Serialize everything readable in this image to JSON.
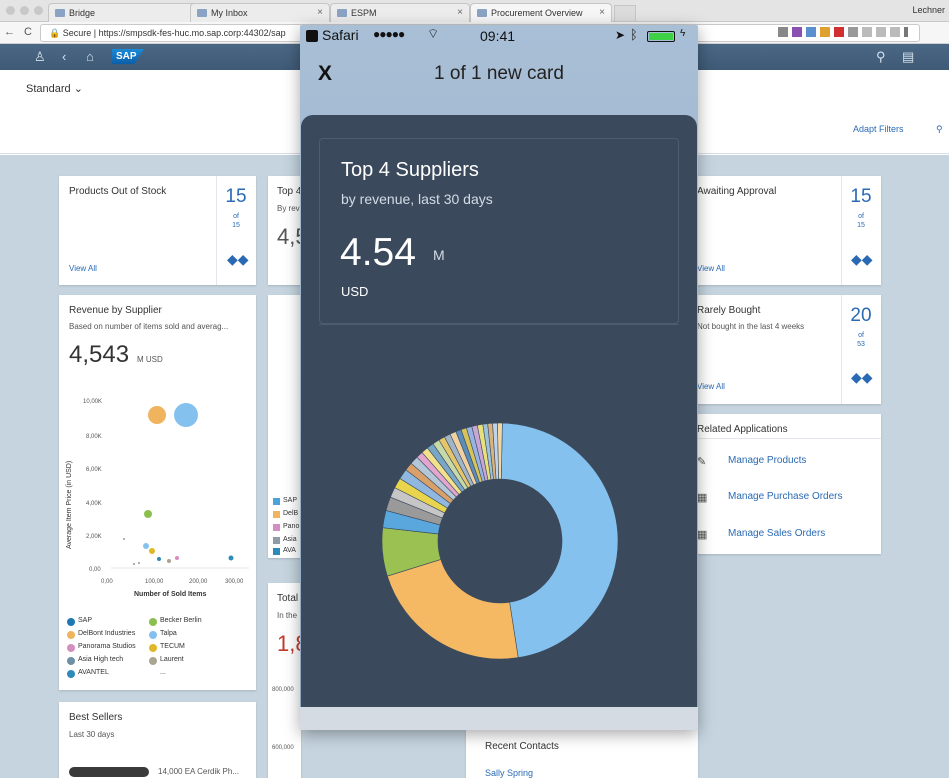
{
  "browser": {
    "tabs": [
      {
        "label": "Bridge"
      },
      {
        "label": "My Inbox"
      },
      {
        "label": "ESPM"
      },
      {
        "label": "Procurement Overview"
      }
    ],
    "user": "Lechner",
    "address": "Secure | https://smpsdk-fes-huc.mo.sap.corp:44302/sap"
  },
  "shell": {
    "logo": "SAP"
  },
  "header": {
    "variant": "Standard",
    "adapt_filters": "Adapt Filters"
  },
  "cards": {
    "out_of_stock": {
      "title": "Products Out of Stock",
      "kpi": "15",
      "of": "of",
      "total": "15",
      "view_all": "View All"
    },
    "top_partial": {
      "title": "Top 4",
      "subtitle": "By rev",
      "kpi": "4,5"
    },
    "revenue": {
      "title": "Revenue by Supplier",
      "subtitle": "Based on number of items sold and averag...",
      "kpi": "4,543",
      "unit": "M USD",
      "ylabel": "Average Item Price (in USD)",
      "xlabel": "Number of Sold Items",
      "yticks": [
        "10,00K",
        "8,00K",
        "6,00K",
        "4,00K",
        "2,00K",
        "0,00"
      ],
      "xticks": [
        "0,00",
        "100,00",
        "200,00",
        "300,00"
      ],
      "legend": [
        {
          "label": "SAP",
          "color": "#1f77b4"
        },
        {
          "label": "Becker Berlin",
          "color": "#8bbf4d"
        },
        {
          "label": "DelBont Industries",
          "color": "#f0b35e"
        },
        {
          "label": "Talpa",
          "color": "#85c1ef"
        },
        {
          "label": "Panorama Studios",
          "color": "#d48fc1"
        },
        {
          "label": "TECUM",
          "color": "#e0b726"
        },
        {
          "label": "Asia High tech",
          "color": "#6e8fa4"
        },
        {
          "label": "Laurent",
          "color": "#a9a590"
        },
        {
          "label": "AVANTEL",
          "color": "#2e8ab8"
        },
        {
          "label": "...",
          "color": ""
        }
      ]
    },
    "awaiting": {
      "title": "Awaiting Approval",
      "kpi": "15",
      "of": "of",
      "total": "15",
      "view_all": "View All"
    },
    "rarely": {
      "title": "Rarely Bought",
      "subtitle": "Not bought in the last 4 weeks",
      "kpi": "20",
      "of": "of",
      "total": "53",
      "view_all": "View All"
    },
    "related": {
      "title": "Related Applications",
      "links": [
        "Manage Products",
        "Manage Purchase Orders",
        "Manage Sales Orders"
      ]
    },
    "legend_partial": [
      "SAP",
      "DelB",
      "Pano",
      "Asia",
      "AVA"
    ],
    "total": {
      "title": "Total",
      "subtitle": "In the",
      "kpi": "1,8",
      "ticks": [
        "800,000",
        "600,000"
      ]
    },
    "best_sellers": {
      "title": "Best Sellers",
      "subtitle": "Last 30 days",
      "row": "14,000 EA Cerdik Ph..."
    },
    "recent_contacts": {
      "title": "Recent Contacts",
      "first": "Sally Spring"
    }
  },
  "phone": {
    "status": {
      "carrier": "Safari",
      "signal": "●●●●●",
      "time": "09:41"
    },
    "header": {
      "close": "X",
      "title": "1 of 1 new card"
    },
    "card": {
      "title": "Top 4 Suppliers",
      "subtitle": "by revenue, last 30 days",
      "value": "4.54",
      "scale": "M",
      "currency": "USD"
    }
  },
  "chart_data": {
    "type": "pie",
    "donut": true,
    "values": [
      50,
      24,
      7,
      2.5,
      2,
      1.5,
      1.5,
      1.5,
      1.2,
      1.2,
      1,
      1,
      1,
      1,
      0.9,
      0.9,
      0.9,
      0.8,
      0.8,
      0.8,
      0.8,
      0.8,
      0.7,
      0.7,
      0.7,
      0.7
    ],
    "colors": [
      "#85c1ef",
      "#f5b964",
      "#9bc152",
      "#5aa7de",
      "#9a9a9a",
      "#c6c6c6",
      "#e8d44d",
      "#8fb7e0",
      "#d9a06a",
      "#b3c7d8",
      "#e2a5ce",
      "#f3e08a",
      "#7aa7c7",
      "#c8d9a8",
      "#e5c66a",
      "#a1b5c6",
      "#f0cfa0",
      "#5b8db8",
      "#d8c35b",
      "#96b3e4",
      "#c9a5d6",
      "#e8e07a",
      "#9ec2d9",
      "#dab27b",
      "#bfd4ec",
      "#f0d8a2"
    ]
  }
}
